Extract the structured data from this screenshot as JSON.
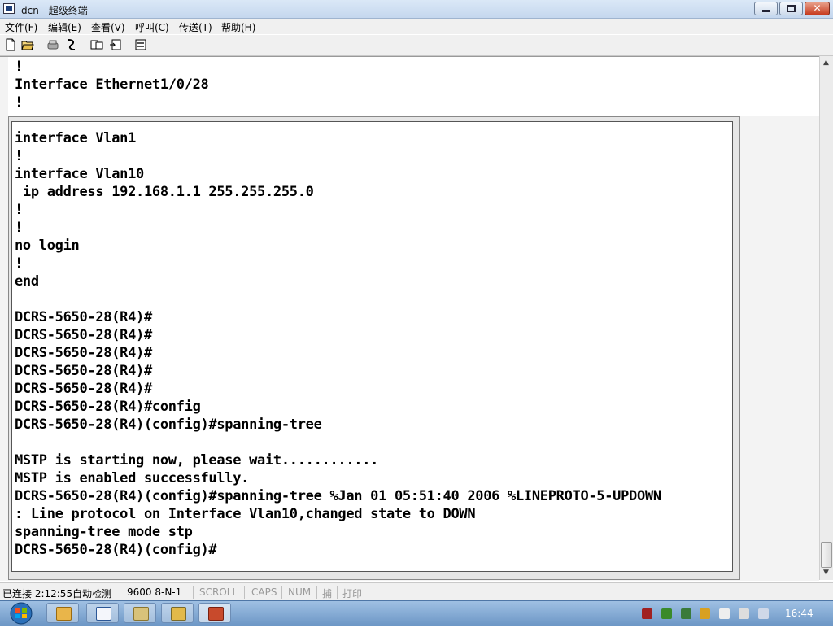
{
  "window": {
    "title": "dcn - 超级终端",
    "minimize_label": "",
    "close_label": "✕"
  },
  "menu": {
    "items": [
      "文件(F)",
      "编辑(E)",
      "查看(V)",
      "呼叫(C)",
      "传送(T)",
      "帮助(H)"
    ]
  },
  "toolbar": {
    "icons": [
      "new-file-icon",
      "open-folder-icon",
      "call-icon",
      "disconnect-icon",
      "send-icon",
      "receive-icon",
      "properties-icon"
    ]
  },
  "terminal": {
    "top_lines": [
      "!",
      "Interface Ethernet1/0/28",
      "!"
    ],
    "lines": [
      "interface Vlan1",
      "!",
      "interface Vlan10",
      " ip address 192.168.1.1 255.255.255.0",
      "!",
      "!",
      "no login",
      "!",
      "end",
      "",
      "DCRS-5650-28(R4)#",
      "DCRS-5650-28(R4)#",
      "DCRS-5650-28(R4)#",
      "DCRS-5650-28(R4)#",
      "DCRS-5650-28(R4)#",
      "DCRS-5650-28(R4)#config",
      "DCRS-5650-28(R4)(config)#spanning-tree",
      "",
      "MSTP is starting now, please wait............",
      "MSTP is enabled successfully.",
      "DCRS-5650-28(R4)(config)#spanning-tree %Jan 01 05:51:40 2006 %LINEPROTO-5-UPDOWN",
      ": Line protocol on Interface Vlan10,changed state to DOWN",
      "spanning-tree mode stp",
      "DCRS-5650-28(R4)(config)#"
    ]
  },
  "status": {
    "connected": "已连接 2:12:55",
    "detect": "自动检测",
    "baud": "9600 8-N-1",
    "scroll": "SCROLL",
    "caps": "CAPS",
    "num": "NUM",
    "capture": "捕",
    "print": "打印"
  },
  "taskbar": {
    "clock": "16:44",
    "apps": [
      "explorer-folder-icon",
      "word-icon",
      "file-manager-icon",
      "network-icon",
      "hyperterminal-icon"
    ]
  }
}
